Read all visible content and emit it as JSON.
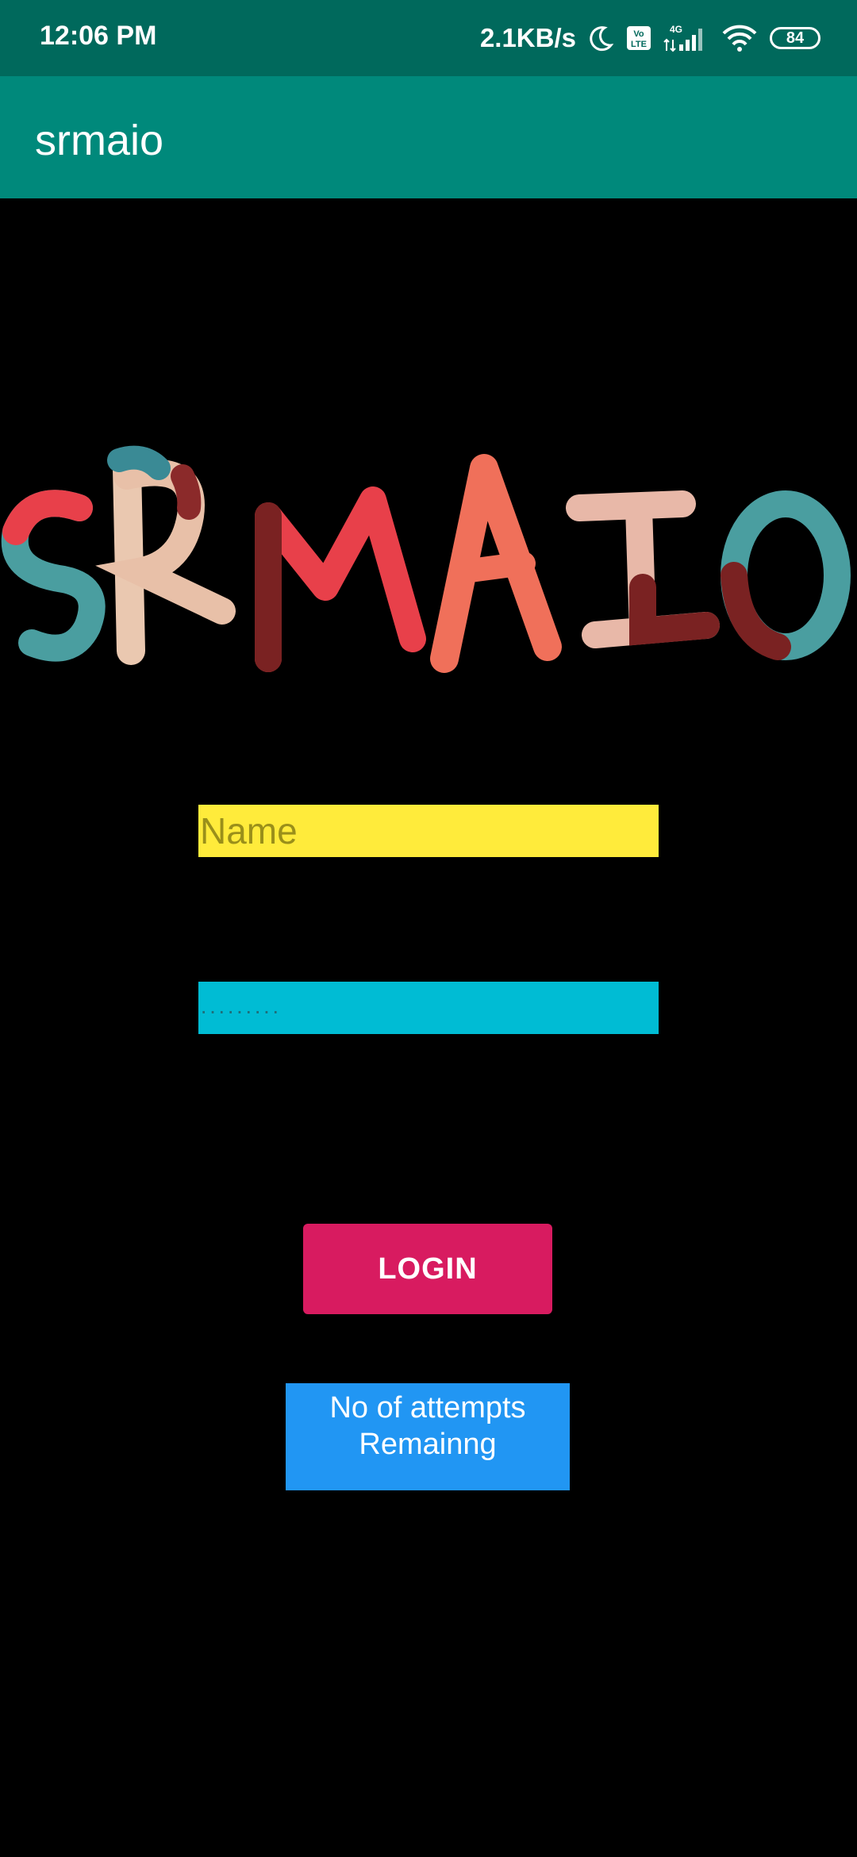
{
  "status_bar": {
    "time": "12:06 PM",
    "net_speed": "2.1KB/s",
    "volte_label": "Vo LTE",
    "network_label": "4G",
    "battery": "84",
    "icons": [
      "moon-icon",
      "volte-icon",
      "signal-icon",
      "wifi-icon",
      "battery-icon"
    ]
  },
  "app_bar": {
    "title": "srmaio"
  },
  "logo": {
    "text": "SRMAIO"
  },
  "form": {
    "name_placeholder": "Name",
    "password_placeholder": "·········",
    "login_label": "LOGIN"
  },
  "attempts": {
    "line1": "No of attempts",
    "line2": "Remainng"
  },
  "colors": {
    "status_bar": "#00695c",
    "app_bar": "#00897b",
    "name_field": "#ffeb3b",
    "password_field": "#00bcd4",
    "login_button": "#d81b60",
    "attempts_box": "#2196f3"
  }
}
